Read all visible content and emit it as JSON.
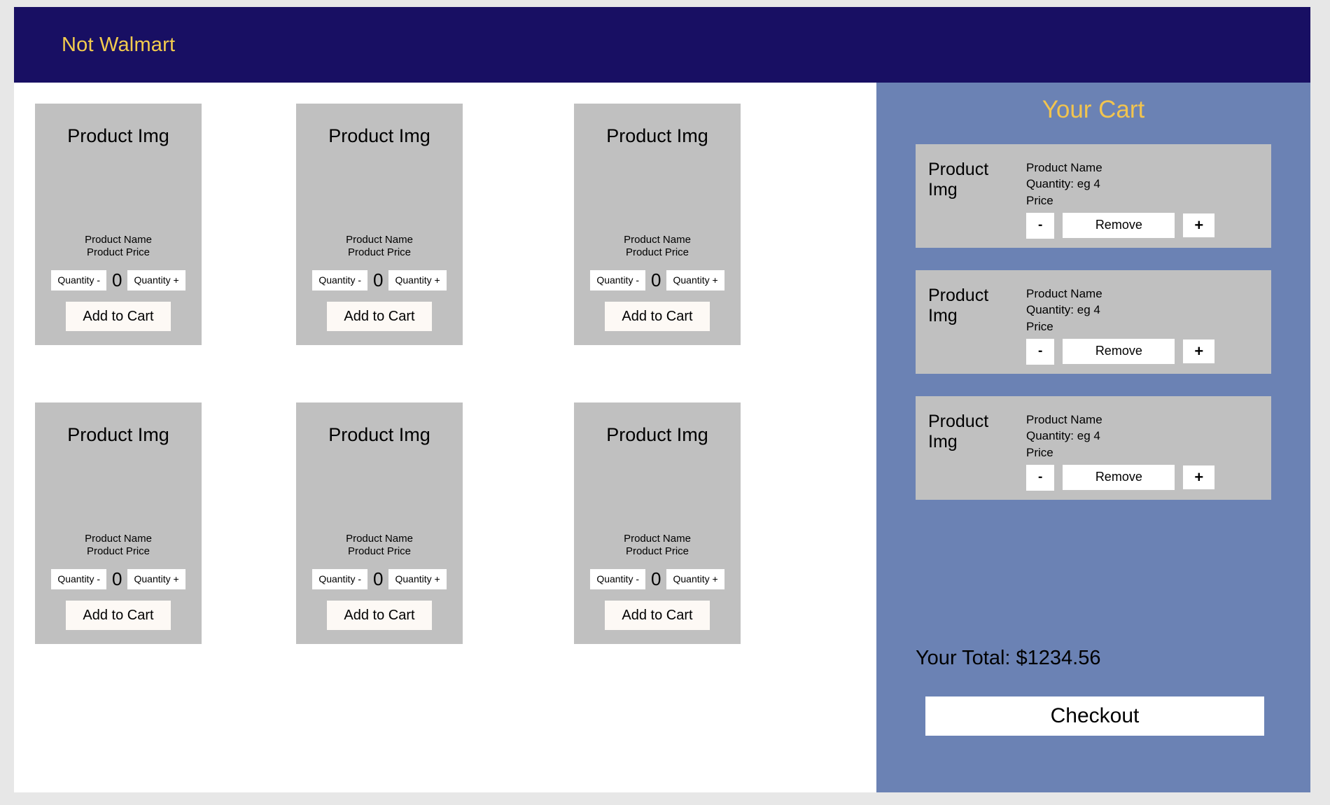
{
  "header": {
    "brand": "Not Walmart",
    "brand_color": "#f2cb4e",
    "background_color": "#180f63"
  },
  "catalog": {
    "background_color": "#ffffff",
    "card_background_color": "#c0c0c0",
    "rows": [
      {
        "cards": [
          {
            "image_label": "Product Img",
            "name": "Product Name",
            "price": "Product Price",
            "qty_minus_label": "Quantity -",
            "qty_value": "0",
            "qty_plus_label": "Quantity +",
            "add_to_cart_label": "Add to Cart"
          },
          {
            "image_label": "Product Img",
            "name": "Product Name",
            "price": "Product Price",
            "qty_minus_label": "Quantity -",
            "qty_value": "0",
            "qty_plus_label": "Quantity +",
            "add_to_cart_label": "Add to Cart"
          },
          {
            "image_label": "Product Img",
            "name": "Product Name",
            "price": "Product Price",
            "qty_minus_label": "Quantity -",
            "qty_value": "0",
            "qty_plus_label": "Quantity +",
            "add_to_cart_label": "Add to Cart"
          }
        ]
      },
      {
        "cards": [
          {
            "image_label": "Product Img",
            "name": "Product Name",
            "price": "Product Price",
            "qty_minus_label": "Quantity -",
            "qty_value": "0",
            "qty_plus_label": "Quantity +",
            "add_to_cart_label": "Add to Cart"
          },
          {
            "image_label": "Product Img",
            "name": "Product Name",
            "price": "Product Price",
            "qty_minus_label": "Quantity -",
            "qty_value": "0",
            "qty_plus_label": "Quantity +",
            "add_to_cart_label": "Add to Cart"
          },
          {
            "image_label": "Product Img",
            "name": "Product Name",
            "price": "Product Price",
            "qty_minus_label": "Quantity -",
            "qty_value": "0",
            "qty_plus_label": "Quantity +",
            "add_to_cart_label": "Add to Cart"
          }
        ]
      }
    ]
  },
  "cart": {
    "title": "Your Cart",
    "title_color": "#f2c44e",
    "background_color": "#6b82b4",
    "item_background_color": "#c0c0c0",
    "items": [
      {
        "image_label": "Product Img",
        "name": "Product Name",
        "quantity": "Quantity: eg 4",
        "price": "Price",
        "minus_label": "-",
        "remove_label": "Remove",
        "plus_label": "+"
      },
      {
        "image_label": "Product Img",
        "name": "Product Name",
        "quantity": "Quantity: eg 4",
        "price": "Price",
        "minus_label": "-",
        "remove_label": "Remove",
        "plus_label": "+"
      },
      {
        "image_label": "Product Img",
        "name": "Product Name",
        "quantity": "Quantity: eg 4",
        "price": "Price",
        "minus_label": "-",
        "remove_label": "Remove",
        "plus_label": "+"
      }
    ],
    "total_label": "Your Total: $1234.56",
    "checkout_label": "Checkout"
  }
}
